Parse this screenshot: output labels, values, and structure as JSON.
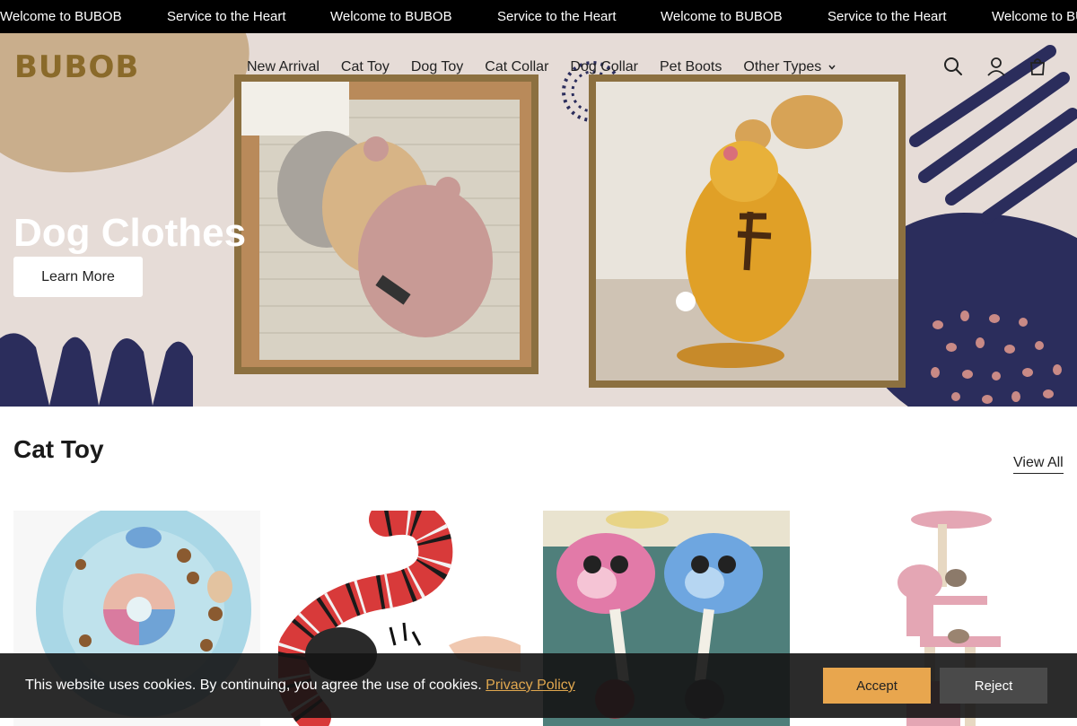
{
  "announcement": {
    "items": [
      "Welcome to BUBOB",
      "Service to the Heart",
      "Welcome to BUBOB",
      "Service to the Heart",
      "Welcome to BUBOB",
      "Service to the Heart",
      "Welcome to BUBOB"
    ]
  },
  "header": {
    "logo": "BUBOB",
    "nav": [
      "New Arrival",
      "Cat Toy",
      "Dog Toy",
      "Cat Collar",
      "Dog Collar",
      "Pet Boots",
      "Other Types"
    ],
    "icons": [
      "search-icon",
      "account-icon",
      "cart-icon"
    ]
  },
  "hero": {
    "title": "Dog Clothes",
    "button": "Learn More"
  },
  "section": {
    "title": "Cat Toy",
    "view_all": "View All",
    "products": [
      "puzzle-feeder",
      "snake-toy",
      "plush-rope-toys",
      "cat-tree"
    ]
  },
  "cookie": {
    "text": "This website uses cookies. By continuing, you agree the use of cookies.",
    "link": "Privacy Policy",
    "accept": "Accept",
    "reject": "Reject"
  },
  "colors": {
    "hero_bg": "#e6dcd7",
    "accent_tan": "#c9ae8c",
    "navy": "#2b2d5c",
    "frame": "#8c7040",
    "accept": "#e8a64e"
  }
}
